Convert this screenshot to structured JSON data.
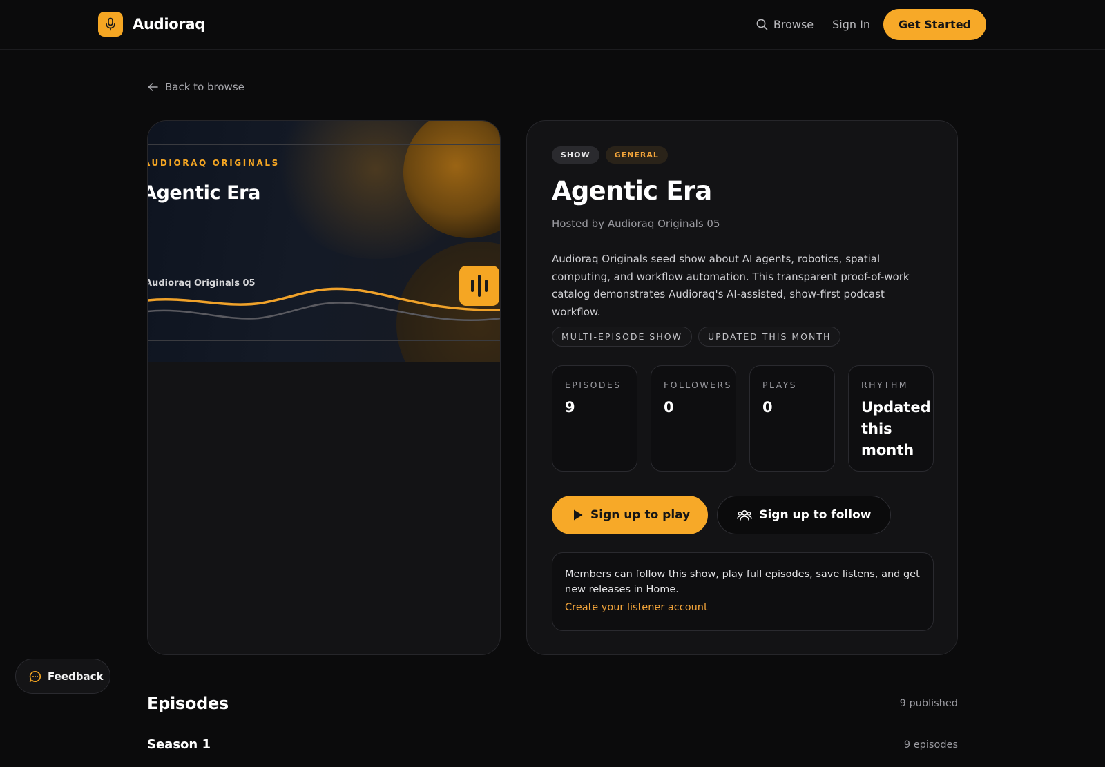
{
  "app": {
    "name": "Audioraq",
    "accent_color": "#f7a928"
  },
  "header": {
    "logo_icon": "microphone-icon",
    "browse_label": "Browse",
    "signin_label": "Sign In",
    "get_started_label": "Get Started"
  },
  "back_link": {
    "label": "Back to browse"
  },
  "cover": {
    "brand": "AUDIORAQ ORIGINALS",
    "title": "Agentic Era",
    "host": "Audioraq Originals 05",
    "icon": "waveform-icon"
  },
  "show": {
    "type_badge": "SHOW",
    "category_badge": "GENERAL",
    "title": "Agentic Era",
    "hosted_by": "Hosted by Audioraq Originals 05",
    "description": "Audioraq Originals seed show about AI agents, robotics, spatial computing, and workflow automation. This transparent proof-of-work catalog demonstrates Audioraq's AI-assisted, show-first podcast workflow.",
    "tags": [
      "MULTI-EPISODE SHOW",
      "UPDATED THIS MONTH"
    ],
    "stats": [
      {
        "label": "EPISODES",
        "value": "9"
      },
      {
        "label": "FOLLOWERS",
        "value": "0"
      },
      {
        "label": "PLAYS",
        "value": "0"
      },
      {
        "label": "RHYTHM",
        "value": "Updated this month"
      }
    ],
    "play_label": "Sign up to play",
    "follow_label": "Sign up to follow",
    "member_text": "Members can follow this show, play full episodes, save listens, and get new releases in Home.",
    "member_link": "Create your listener account"
  },
  "feedback": {
    "label": "Feedback"
  },
  "episodes": {
    "title": "Episodes",
    "count": "9 published",
    "season_title": "Season 1",
    "season_count": "9 episodes"
  }
}
